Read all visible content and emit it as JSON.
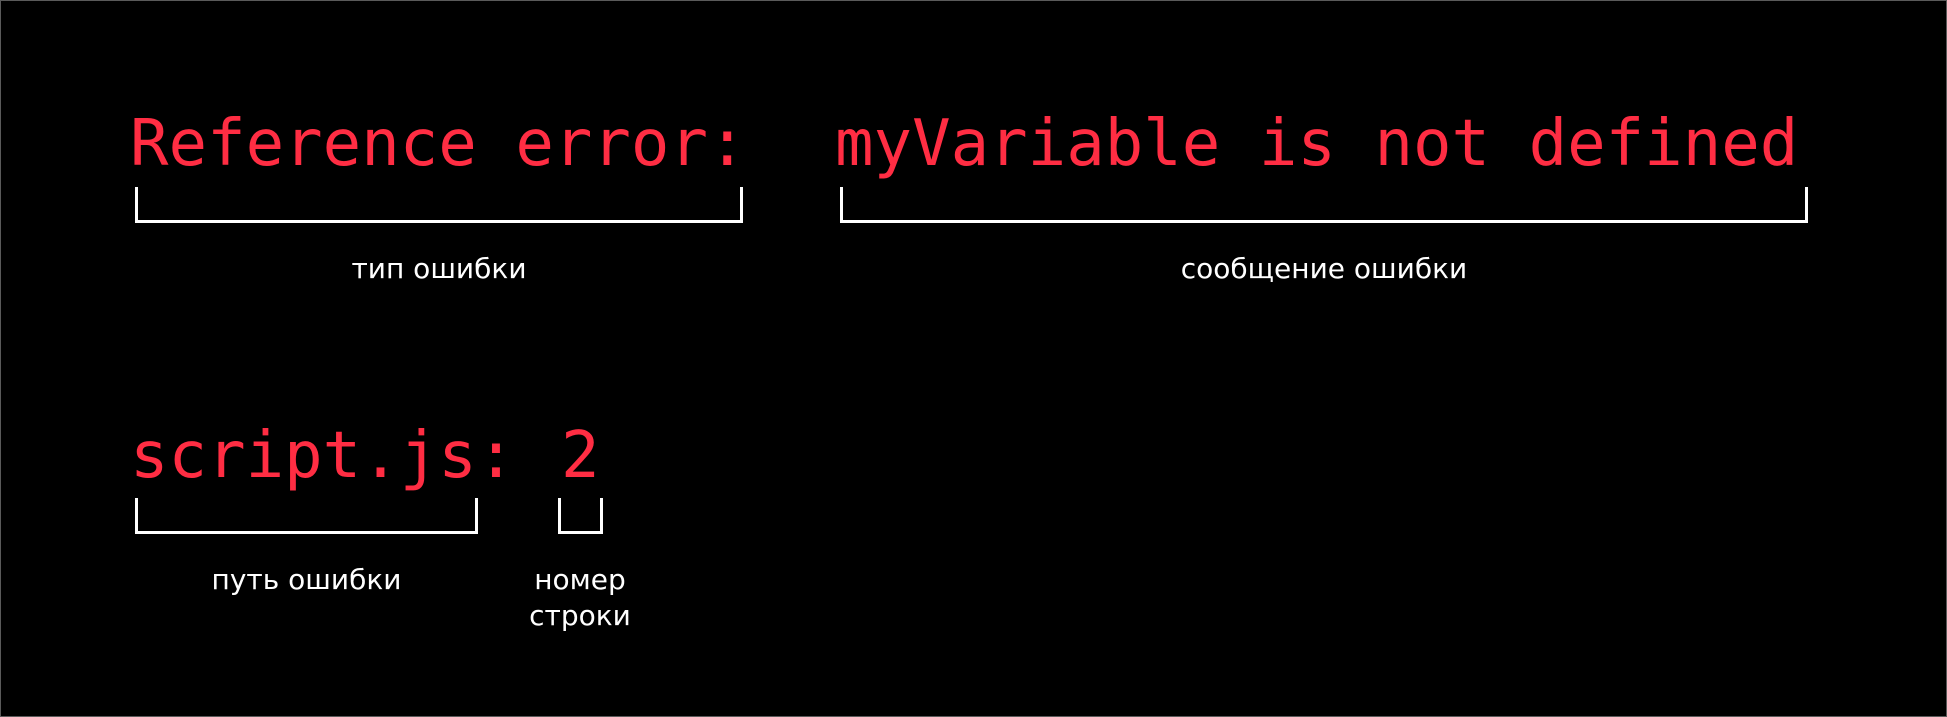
{
  "colors": {
    "background": "#000000",
    "code_text": "#ff2d43",
    "annotation": "#ffffff"
  },
  "error_line": {
    "type_text": "Reference error:",
    "message_text": "myVariable is not defined",
    "type_label": "тип ошибки",
    "message_label": "сообщение ошибки"
  },
  "location_line": {
    "path_text": "script.js:",
    "line_number": "2",
    "path_label": "путь ошибки",
    "line_label": "номер\nстроки"
  }
}
